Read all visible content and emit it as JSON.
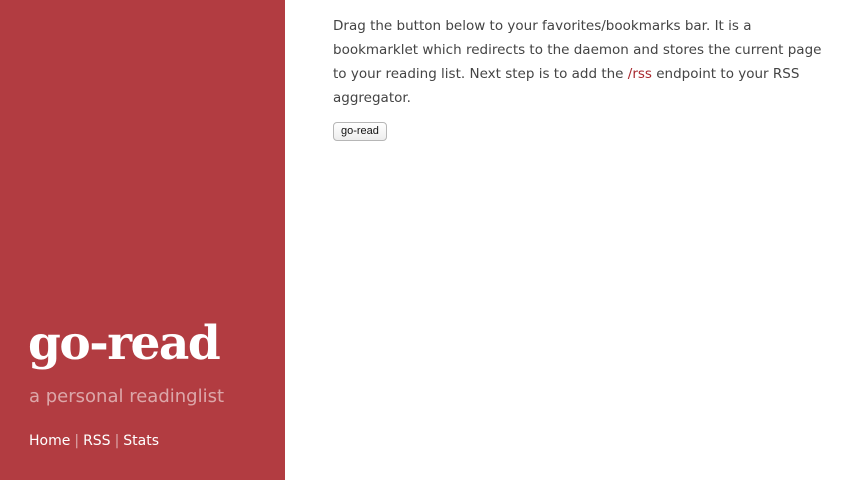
{
  "sidebar": {
    "brand": "go-read",
    "tagline": "a personal readinglist",
    "nav": [
      {
        "label": "Home"
      },
      {
        "label": "RSS"
      },
      {
        "label": "Stats"
      }
    ],
    "separator": "|"
  },
  "main": {
    "intro_before_link": "Drag the button below to your favorites/bookmarks bar. It is a bookmarklet which redirects to the daemon and stores the current page to your reading list. Next step is to add the ",
    "rss_link": "/rss",
    "intro_after_link": " endpoint to your RSS aggregator.",
    "bookmarklet_label": "go-read"
  },
  "colors": {
    "sidebar_bg": "#b23c41",
    "link": "#a8282e",
    "body_text": "#444444"
  }
}
